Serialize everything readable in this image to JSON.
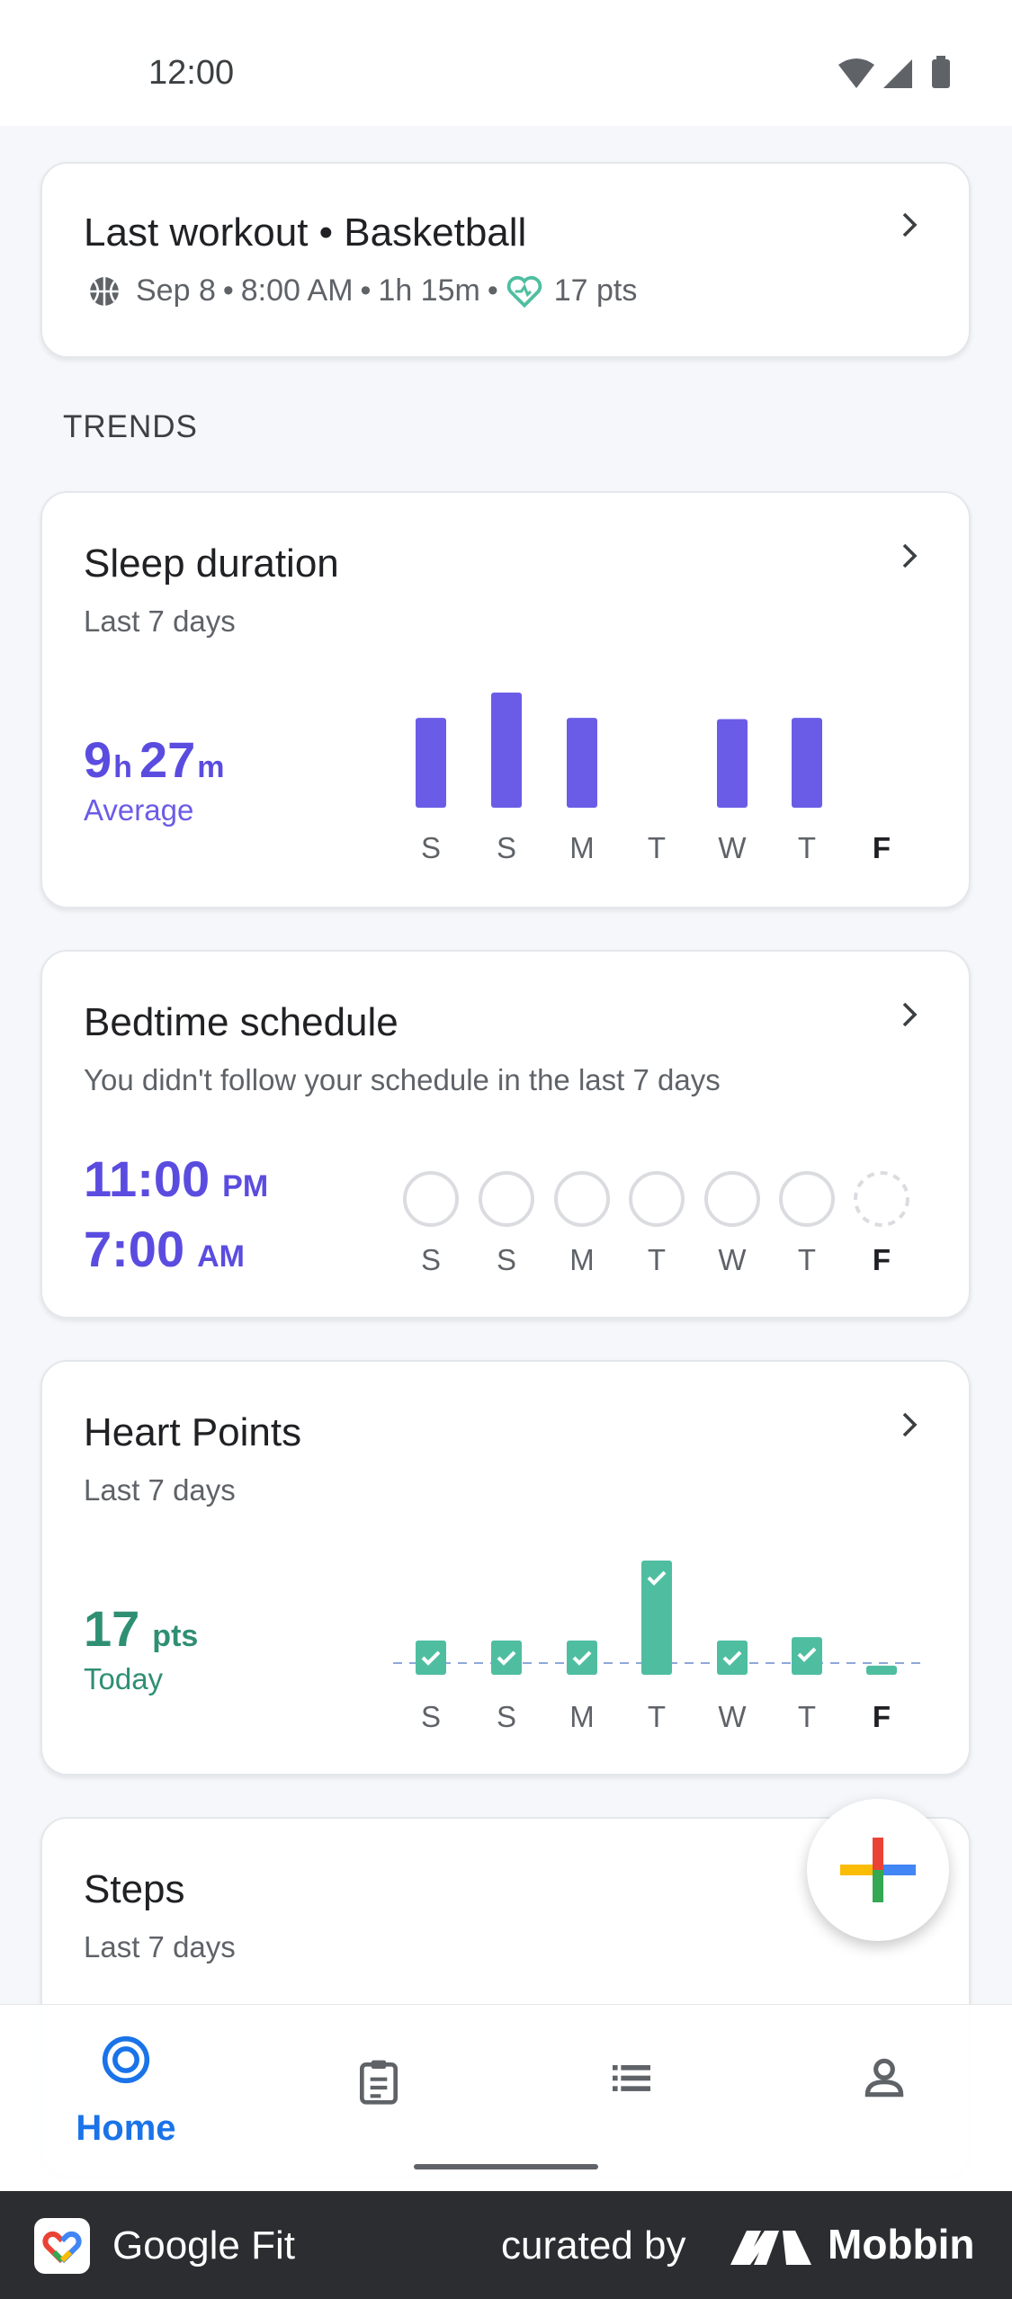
{
  "status_bar": {
    "time": "12:00"
  },
  "last_workout": {
    "title": "Last workout • Basketball",
    "date": "Sep 8",
    "time": "8:00 AM",
    "duration": "1h 15m",
    "points": "17 pts",
    "separator": "•"
  },
  "trends_label": "TRENDS",
  "days": [
    "S",
    "S",
    "M",
    "T",
    "W",
    "T",
    "F"
  ],
  "sleep": {
    "title": "Sleep duration",
    "subtitle": "Last 7 days",
    "avg_hours": "9",
    "hours_unit": "h",
    "avg_minutes": "27",
    "minutes_unit": "m",
    "caption": "Average",
    "accent": "#6b5ce7",
    "values": [
      0.78,
      1.0,
      0.78,
      0,
      0.77,
      0.78,
      0
    ]
  },
  "bedtime": {
    "title": "Bedtime schedule",
    "subtitle": "You didn't follow your schedule in the last 7 days",
    "bed_time": "11:00",
    "bed_period": "PM",
    "wake_time": "7:00",
    "wake_period": "AM"
  },
  "heart_points": {
    "title": "Heart Points",
    "subtitle": "Last 7 days",
    "value": "17",
    "unit": "pts",
    "caption": "Today",
    "accent": "#4fbea0",
    "values": [
      0.3,
      0.3,
      0.3,
      1.0,
      0.3,
      0.33,
      0.08
    ],
    "goal_met": [
      true,
      true,
      true,
      true,
      true,
      true,
      false
    ]
  },
  "steps": {
    "title": "Steps",
    "subtitle": "Last 7 days"
  },
  "nav": {
    "home": "Home"
  },
  "footer": {
    "app_name": "Google Fit",
    "curated_by": "curated by",
    "brand": "Mobbin"
  }
}
